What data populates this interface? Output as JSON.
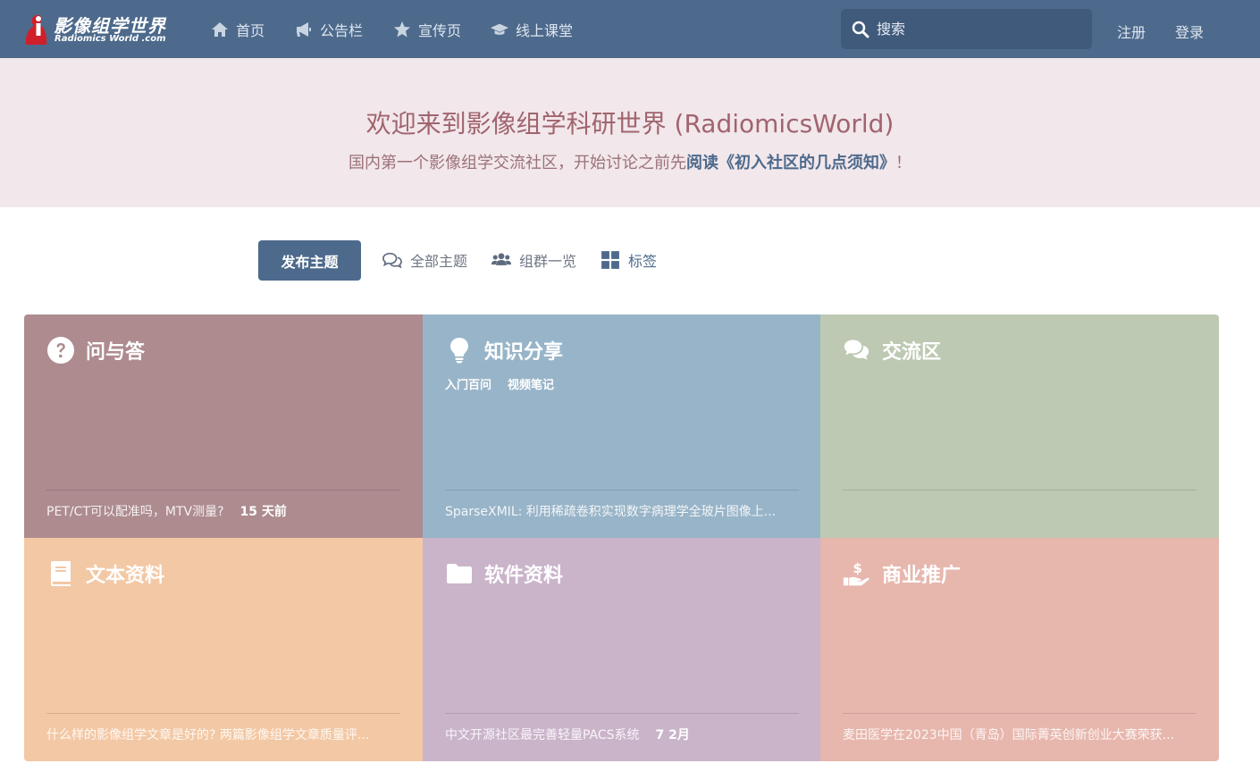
{
  "header": {
    "logo_title": "影像组学世界",
    "logo_subtitle": "Radiomics World .com",
    "nav": [
      {
        "label": "首页",
        "icon": "home-icon"
      },
      {
        "label": "公告栏",
        "icon": "bullhorn-icon"
      },
      {
        "label": "宣传页",
        "icon": "star-icon"
      },
      {
        "label": "线上课堂",
        "icon": "graduation-cap-icon"
      }
    ],
    "search_placeholder": "搜索",
    "register": "注册",
    "login": "登录"
  },
  "hero": {
    "title": "欢迎来到影像组学科研世界 (RadiomicsWorld)",
    "desc_prefix": "国内第一个影像组学交流社区，开始讨论之前先",
    "desc_link": "阅读《初入社区的几点须知》",
    "desc_suffix": "！"
  },
  "toolbar": {
    "new_topic": "发布主题",
    "all_topics": "全部主题",
    "groups": "组群一览",
    "tags": "标签"
  },
  "tiles": [
    {
      "name": "问与答",
      "icon": "question-circle-icon",
      "color": "#ad8b8f",
      "subs": [],
      "last_title": "PET/CT可以配准吗，MTV测量?",
      "last_time": "15 天前"
    },
    {
      "name": "知识分享",
      "icon": "lightbulb-icon",
      "color": "#98b4c8",
      "subs": [
        "入门百问",
        "视频笔记"
      ],
      "last_title": "SparseXMIL: 利用稀疏卷积实现数字病理学全玻片图像上...",
      "last_time": ""
    },
    {
      "name": "交流区",
      "icon": "comments-icon",
      "color": "#bdc9b2",
      "subs": [],
      "last_title": "",
      "last_time": ""
    },
    {
      "name": "文本资料",
      "icon": "book-icon",
      "color": "#f3c8a5",
      "subs": [],
      "last_title": "什么样的影像组学文章是好的? 两篇影像组学文章质量评...",
      "last_time": ""
    },
    {
      "name": "软件资料",
      "icon": "folder-icon",
      "color": "#cab4ca",
      "subs": [],
      "last_title": "中文开源社区最完善轻量PACS系统",
      "last_time": "7 2月"
    },
    {
      "name": "商业推广",
      "icon": "hand-holding-usd-icon",
      "color": "#e7b7ad",
      "subs": [],
      "last_title": "麦田医学在2023中国（青岛）国际菁英创新创业大赛荣获...",
      "last_time": ""
    }
  ]
}
